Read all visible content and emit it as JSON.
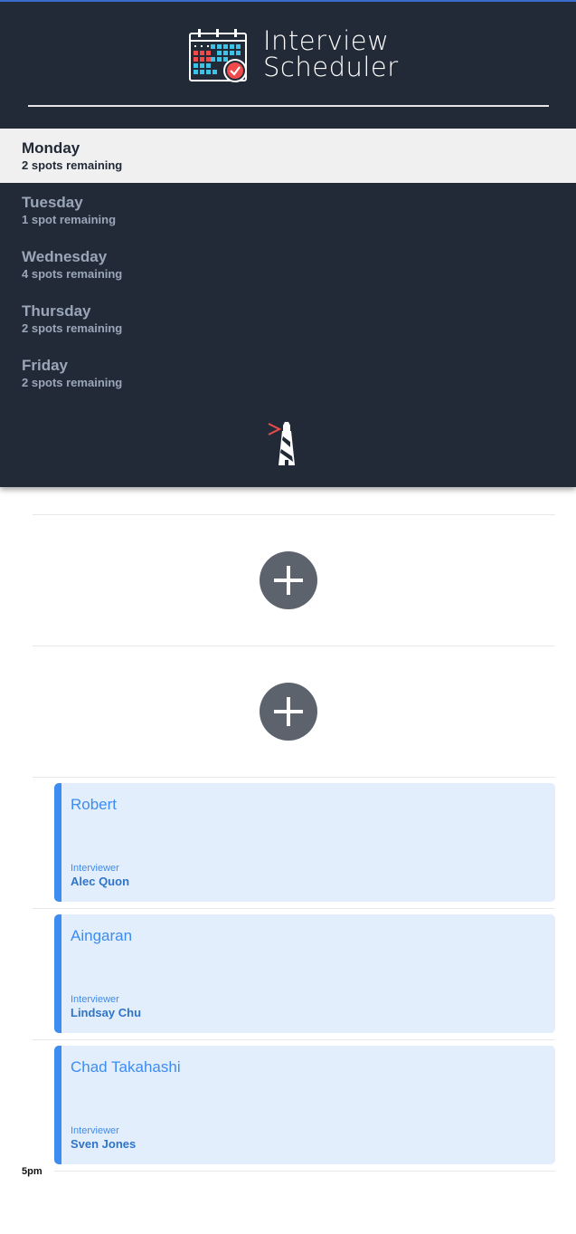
{
  "app": {
    "title_line1": "Interview",
    "title_line2": "Scheduler",
    "accent_color": "#3b6fd6",
    "sidebar_bg": "#222a38"
  },
  "days": [
    {
      "name": "Monday",
      "spots": "2 spots remaining",
      "selected": true
    },
    {
      "name": "Tuesday",
      "spots": "1 spot remaining",
      "selected": false
    },
    {
      "name": "Wednesday",
      "spots": "4 spots remaining",
      "selected": false
    },
    {
      "name": "Thursday",
      "spots": "2 spots remaining",
      "selected": false
    },
    {
      "name": "Friday",
      "spots": "2 spots remaining",
      "selected": false
    }
  ],
  "appointments": [
    {
      "type": "empty"
    },
    {
      "type": "empty"
    },
    {
      "type": "booked",
      "student": "Robert",
      "role_label": "Interviewer",
      "interviewer": "Alec Quon"
    },
    {
      "type": "booked",
      "student": "Aingaran",
      "role_label": "Interviewer",
      "interviewer": "Lindsay Chu"
    },
    {
      "type": "booked",
      "student": "Chad Takahashi",
      "role_label": "Interviewer",
      "interviewer": "Sven Jones"
    }
  ],
  "final_time": "5pm",
  "icons": {
    "brand": "calendar-check-icon",
    "logo": "lighthouse-icon",
    "add": "plus-icon"
  }
}
